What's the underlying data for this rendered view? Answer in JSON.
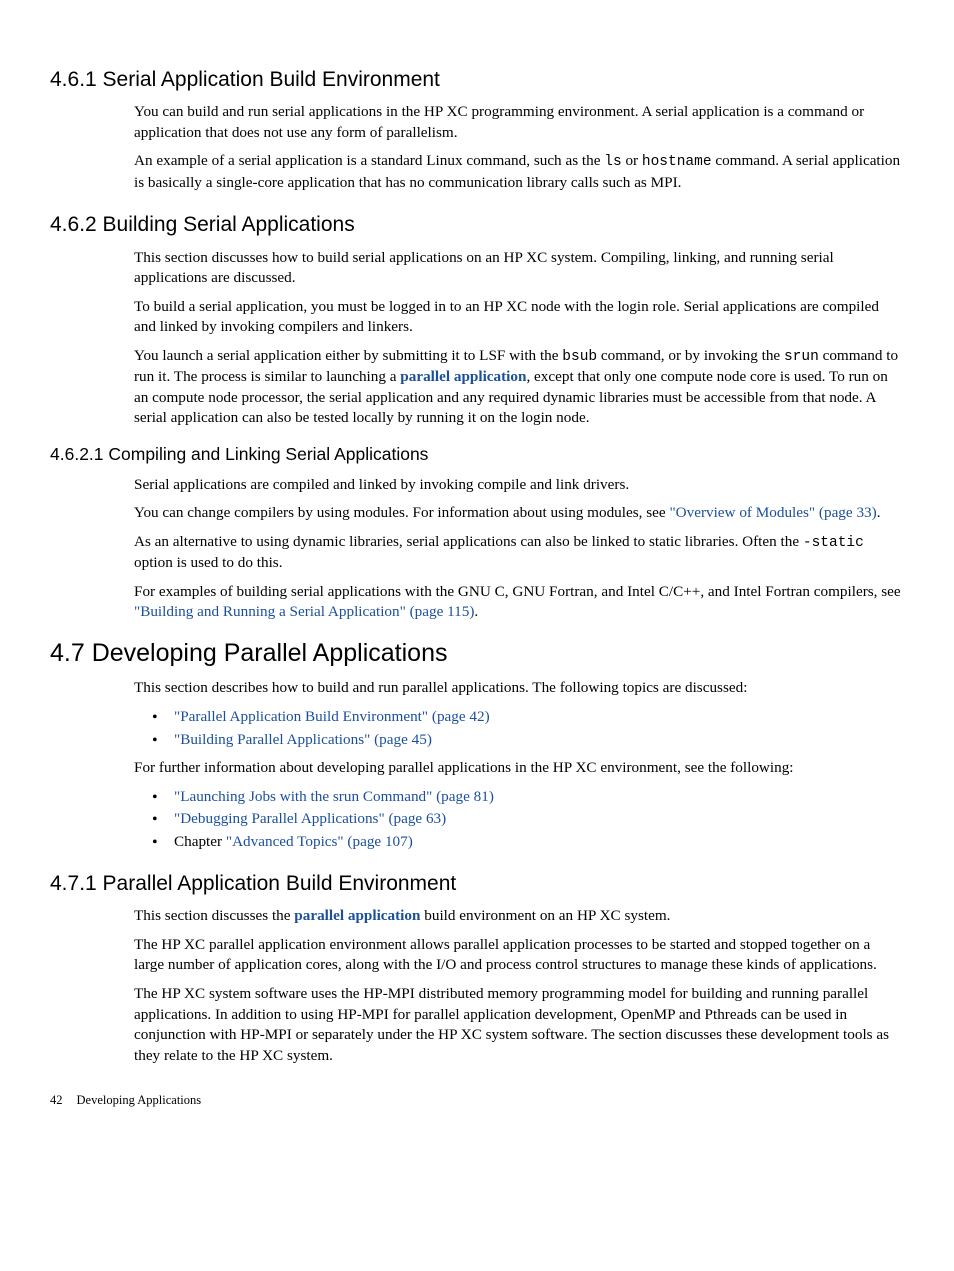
{
  "s461": {
    "heading": "4.6.1 Serial Application Build Environment",
    "p1_a": "You can build and run serial applications in the HP XC programming environment. A serial application is a command or application that does not use any form of parallelism.",
    "p2_a": "An example of a serial application is a standard Linux command, such as the ",
    "p2_code1": "ls",
    "p2_b": " or ",
    "p2_code2": "hostname",
    "p2_c": " command. A serial application is basically a single-core application that has no communication library calls such as MPI."
  },
  "s462": {
    "heading": "4.6.2 Building Serial Applications",
    "p1": "This section discusses how to build serial applications on an HP XC system. Compiling, linking, and running serial applications are discussed.",
    "p2": "To build a serial application, you must be logged in to an HP XC node with the login role. Serial applications are compiled and linked by invoking compilers and linkers.",
    "p3_a": "You launch a serial application either by submitting it to LSF with the ",
    "p3_code1": "bsub",
    "p3_b": " command, or by invoking the ",
    "p3_code2": "srun",
    "p3_c": " command to run it. The process is similar to launching a ",
    "p3_link": "parallel application",
    "p3_d": ", except that only one compute node core is used. To run on an compute node processor, the serial application and any required dynamic libraries must be accessible from that node. A serial application can also be tested locally by running it on the login node."
  },
  "s4621": {
    "heading": "4.6.2.1 Compiling and Linking Serial Applications",
    "p1": "Serial applications are compiled and linked by invoking compile and link drivers.",
    "p2_a": "You can change compilers by using modules. For information about using modules, see ",
    "p2_link": "\"Overview of Modules\" (page 33)",
    "p2_b": ".",
    "p3_a": "As an alternative to using dynamic libraries, serial applications can also be linked to static libraries. Often the ",
    "p3_code": "-static",
    "p3_b": " option is used to do this.",
    "p4_a": "For examples of building serial applications with the GNU C, GNU Fortran, and Intel C/C++, and Intel Fortran compilers, see ",
    "p4_link": "\"Building and Running a Serial Application\" (page 115)",
    "p4_b": "."
  },
  "s47": {
    "heading": "4.7 Developing Parallel Applications",
    "p1": "This section describes how to build and run parallel applications. The following topics are discussed:",
    "bullets1": {
      "0": "\"Parallel Application Build Environment\" (page 42)",
      "1": "\"Building Parallel Applications\" (page 45)"
    },
    "p2": "For further information about developing parallel applications in the HP XC environment, see the following:",
    "bullets2": {
      "0": "\"Launching Jobs with the srun Command\" (page 81)",
      "1": "\"Debugging Parallel Applications\" (page 63)",
      "2_a": "Chapter ",
      "2_link": "\"Advanced Topics\" (page 107)"
    }
  },
  "s471": {
    "heading": "4.7.1 Parallel Application Build Environment",
    "p1_a": "This section discusses the ",
    "p1_link": "parallel application",
    "p1_b": " build environment on an HP XC system.",
    "p2": "The HP XC parallel application environment allows parallel application processes to be started and stopped together on a large number of application cores, along with the I/O and process control structures to manage these kinds of applications.",
    "p3": "The HP XC system software uses the HP-MPI distributed memory programming model for building and running parallel applications. In addition to using HP-MPI for parallel application development, OpenMP and Pthreads can be used in conjunction with HP-MPI or separately under the HP XC system software. The section discusses these development tools as they relate to the HP XC system."
  },
  "footer": {
    "page": "42",
    "title": "Developing Applications"
  }
}
